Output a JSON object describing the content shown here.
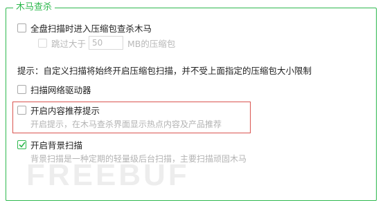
{
  "group": {
    "title": "木马查杀"
  },
  "options": {
    "scan_archives": {
      "label": "全盘扫描时进入压缩包查杀木马",
      "checked": false
    },
    "skip_large": {
      "label_before": "跳过大于",
      "value": "50",
      "label_after": "MB的压缩包",
      "enabled": false
    },
    "hint": "提示：自定义扫描将始终开启压缩包扫描，并不受上面指定的压缩包大小限制",
    "scan_network_drives": {
      "label": "扫描网络驱动器",
      "checked": false
    },
    "content_recommend": {
      "label": "开启内容推荐提示",
      "desc": "开启提示，在木马查杀界面显示热点内容及产品推荐",
      "checked": false
    },
    "background_scan": {
      "label": "开启背景扫描",
      "desc": "背景扫描是一种定期的轻量级后台扫描，主要扫描顽固木马",
      "checked": true
    }
  },
  "watermark": "FREEBUF",
  "colors": {
    "accent": "#2db84d",
    "highlight": "#d9534f"
  }
}
